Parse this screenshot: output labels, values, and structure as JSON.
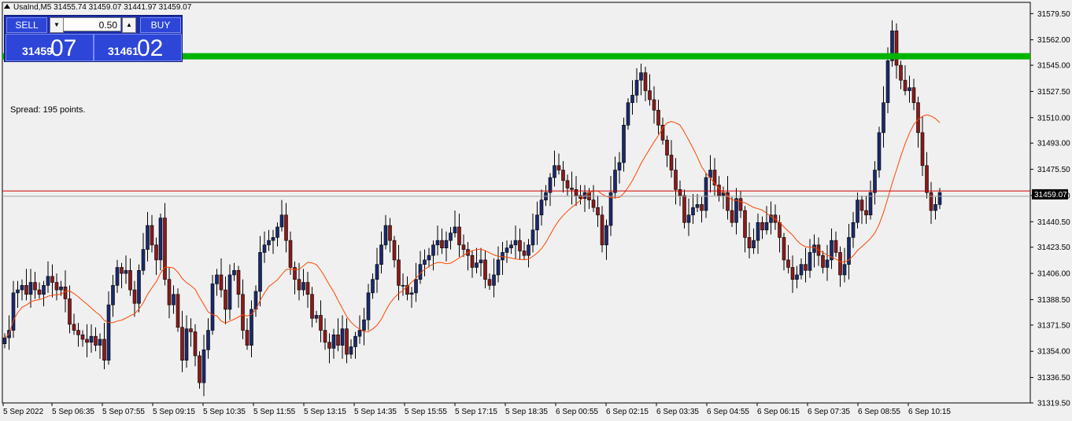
{
  "header": {
    "symbol_info": "UsaInd,M5  31455.74 31459.07 31441.97 31459.07"
  },
  "trade_panel": {
    "sell_label": "SELL",
    "buy_label": "BUY",
    "volume": "0.50",
    "sell_price_small": "31459",
    "sell_price_big": "07",
    "buy_price_small": "31461",
    "buy_price_big": "02"
  },
  "spread_text": "Spread: 195 points.",
  "chart_data": {
    "type": "candlestick",
    "ylim": [
      31319.5,
      31587
    ],
    "y_ticks": [
      "31579.50",
      "31562.00",
      "31545.00",
      "31527.50",
      "31510.00",
      "31493.00",
      "31475.50",
      "31458.00",
      "31440.50",
      "31423.50",
      "31406.00",
      "31388.50",
      "31371.50",
      "31354.00",
      "31336.50",
      "31319.50"
    ],
    "y_tick_values": [
      31579.5,
      31562,
      31545,
      31527.5,
      31510,
      31493,
      31475.5,
      31458,
      31440.5,
      31423.5,
      31406,
      31388.5,
      31371.5,
      31354,
      31336.5,
      31319.5
    ],
    "x_ticks": [
      "5 Sep 2022",
      "5 Sep 06:35",
      "5 Sep 07:55",
      "5 Sep 09:15",
      "5 Sep 10:35",
      "5 Sep 11:55",
      "5 Sep 13:15",
      "5 Sep 14:35",
      "5 Sep 15:55",
      "5 Sep 17:15",
      "5 Sep 18:35",
      "6 Sep 00:55",
      "6 Sep 02:15",
      "6 Sep 03:35",
      "6 Sep 04:55",
      "6 Sep 06:15",
      "6 Sep 07:35",
      "6 Sep 08:55",
      "6 Sep 10:15"
    ],
    "current_price": "31459.07",
    "bid": 31459.07,
    "ask": 31461.02,
    "resistance_level": 31551,
    "colors": {
      "bull": "#1a2a6c",
      "bear": "#8b1a1a",
      "ma": "#ff4500",
      "level": "#00b400",
      "bid_line": "#cc0000",
      "bg": "#f0f0f0"
    },
    "closes": [
      31363,
      31368,
      31393,
      31395,
      31398,
      31392,
      31400,
      31395,
      31392,
      31398,
      31404,
      31400,
      31395,
      31397,
      31389,
      31372,
      31368,
      31365,
      31362,
      31360,
      31364,
      31358,
      31362,
      31348,
      31385,
      31398,
      31410,
      31406,
      31408,
      31395,
      31386,
      31408,
      31422,
      31438,
      31425,
      31415,
      31443,
      31402,
      31385,
      31392,
      31370,
      31348,
      31369,
      31367,
      31351,
      31333,
      31355,
      31368,
      31399,
      31405,
      31395,
      31382,
      31405,
      31408,
      31392,
      31368,
      31358,
      31382,
      31394,
      31420,
      31425,
      31428,
      31430,
      31437,
      31445,
      31428,
      31410,
      31402,
      31395,
      31400,
      31392,
      31376,
      31378,
      31368,
      31360,
      31356,
      31365,
      31358,
      31369,
      31352,
      31357,
      31364,
      31368,
      31375,
      31393,
      31402,
      31412,
      31425,
      31438,
      31428,
      31415,
      31398,
      31398,
      31392,
      31393,
      31402,
      31412,
      31415,
      31418,
      31425,
      31428,
      31423,
      31428,
      31433,
      31437,
      31425,
      31422,
      31418,
      31410,
      31413,
      31415,
      31402,
      31398,
      31405,
      31415,
      31420,
      31423,
      31425,
      31428,
      31421,
      31418,
      31425,
      31435,
      31445,
      31455,
      31460,
      31470,
      31478,
      31475,
      31468,
      31463,
      31462,
      31458,
      31456,
      31460,
      31455,
      31450,
      31445,
      31425,
      31438,
      31460,
      31475,
      31480,
      31505,
      31520,
      31525,
      31535,
      31540,
      31528,
      31522,
      31515,
      31505,
      31495,
      31485,
      31475,
      31462,
      31458,
      31440,
      31445,
      31450,
      31452,
      31448,
      31470,
      31475,
      31465,
      31458,
      31460,
      31448,
      31440,
      31456,
      31448,
      31430,
      31423,
      31428,
      31440,
      31435,
      31440,
      31445,
      31440,
      31430,
      31415,
      31410,
      31402,
      31405,
      31412,
      31408,
      31420,
      31425,
      31418,
      31410,
      31415,
      31428,
      31420,
      31405,
      31412,
      31430,
      31440,
      31455,
      31448,
      31445,
      31460,
      31475,
      31500,
      31520,
      31548,
      31568,
      31545,
      31535,
      31528,
      31530,
      31520,
      31500,
      31478,
      31460,
      31448,
      31452,
      31460
    ]
  }
}
